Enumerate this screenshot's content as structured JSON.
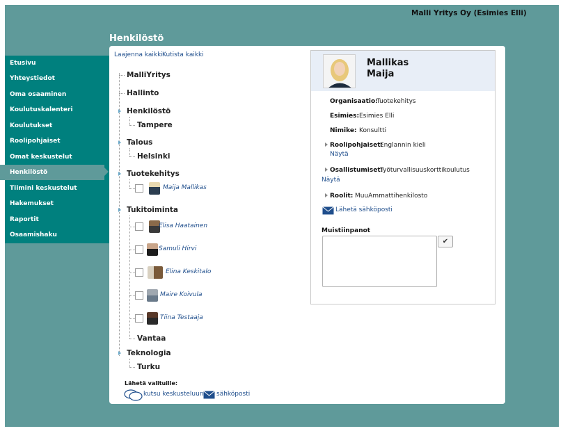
{
  "header": {
    "company": "Malli Yritys Oy (Esimies Elli)",
    "page_title": "Henkilöstö"
  },
  "sidebar": {
    "items": [
      {
        "label": "Etusivu"
      },
      {
        "label": "Yhteystiedot"
      },
      {
        "label": "Oma osaaminen"
      },
      {
        "label": "Koulutuskalenteri"
      },
      {
        "label": "Koulutukset"
      },
      {
        "label": "Roolipohjaiset"
      },
      {
        "label": "Omat keskustelut"
      },
      {
        "label": "Henkilöstö",
        "active": true
      },
      {
        "label": "Tiimini keskustelut"
      },
      {
        "label": "Hakemukset"
      },
      {
        "label": "Raportit"
      },
      {
        "label": "Osaamishaku"
      }
    ]
  },
  "tree": {
    "expand_all": "Laajenna kaikki",
    "collapse_all": "Kutista kaikki",
    "nodes": {
      "root": "MalliYritys",
      "hallinto": "Hallinto",
      "henkilosto": "Henkilöstö",
      "tampere": "Tampere",
      "talous": "Talous",
      "helsinki": "Helsinki",
      "tuotekehitys": "Tuotekehitys",
      "tukitoiminta": "Tukitoiminta",
      "vantaa": "Vantaa",
      "teknologia": "Teknologia",
      "turku": "Turku"
    },
    "people": {
      "maija": "Maija Mallikas",
      "elisa": "Elisa Haatainen",
      "samuli": "Samuli Hirvi",
      "elina": "Elina Keskitalo",
      "maire": "Maire Koivula",
      "tiina": "Tiina Testaaja"
    },
    "send_label": "Lähetä valituille:",
    "invite_link": "kutsu keskusteluun",
    "email_link": "sähköposti"
  },
  "detail": {
    "last_name": "Mallikas",
    "first_name": "Maija",
    "org_label": "Organisaatio:",
    "org_value": "Tuotekehitys",
    "boss_label": "Esimies:",
    "boss_value": "Esimies Elli",
    "title_label": "Nimike:",
    "title_value": "Konsultti",
    "role_based_label": "Roolipohjaiset:",
    "role_based_value": "Englannin kieli",
    "show1": "Näytä",
    "participation_label": "Osallistumiset:",
    "participation_value": "Työturvallisuuskorttikoulutus",
    "show2": "Näytä",
    "roles_label": "Roolit:",
    "roles_value": "MuuAmmattihenkilosto",
    "send_email": "Lähetä sähköposti",
    "notes_label": "Muistiinpanot",
    "notes_value": ""
  },
  "colors": {
    "frame": "#5f9a9a",
    "sidebar": "#00807e",
    "link": "#1f4e8c"
  }
}
